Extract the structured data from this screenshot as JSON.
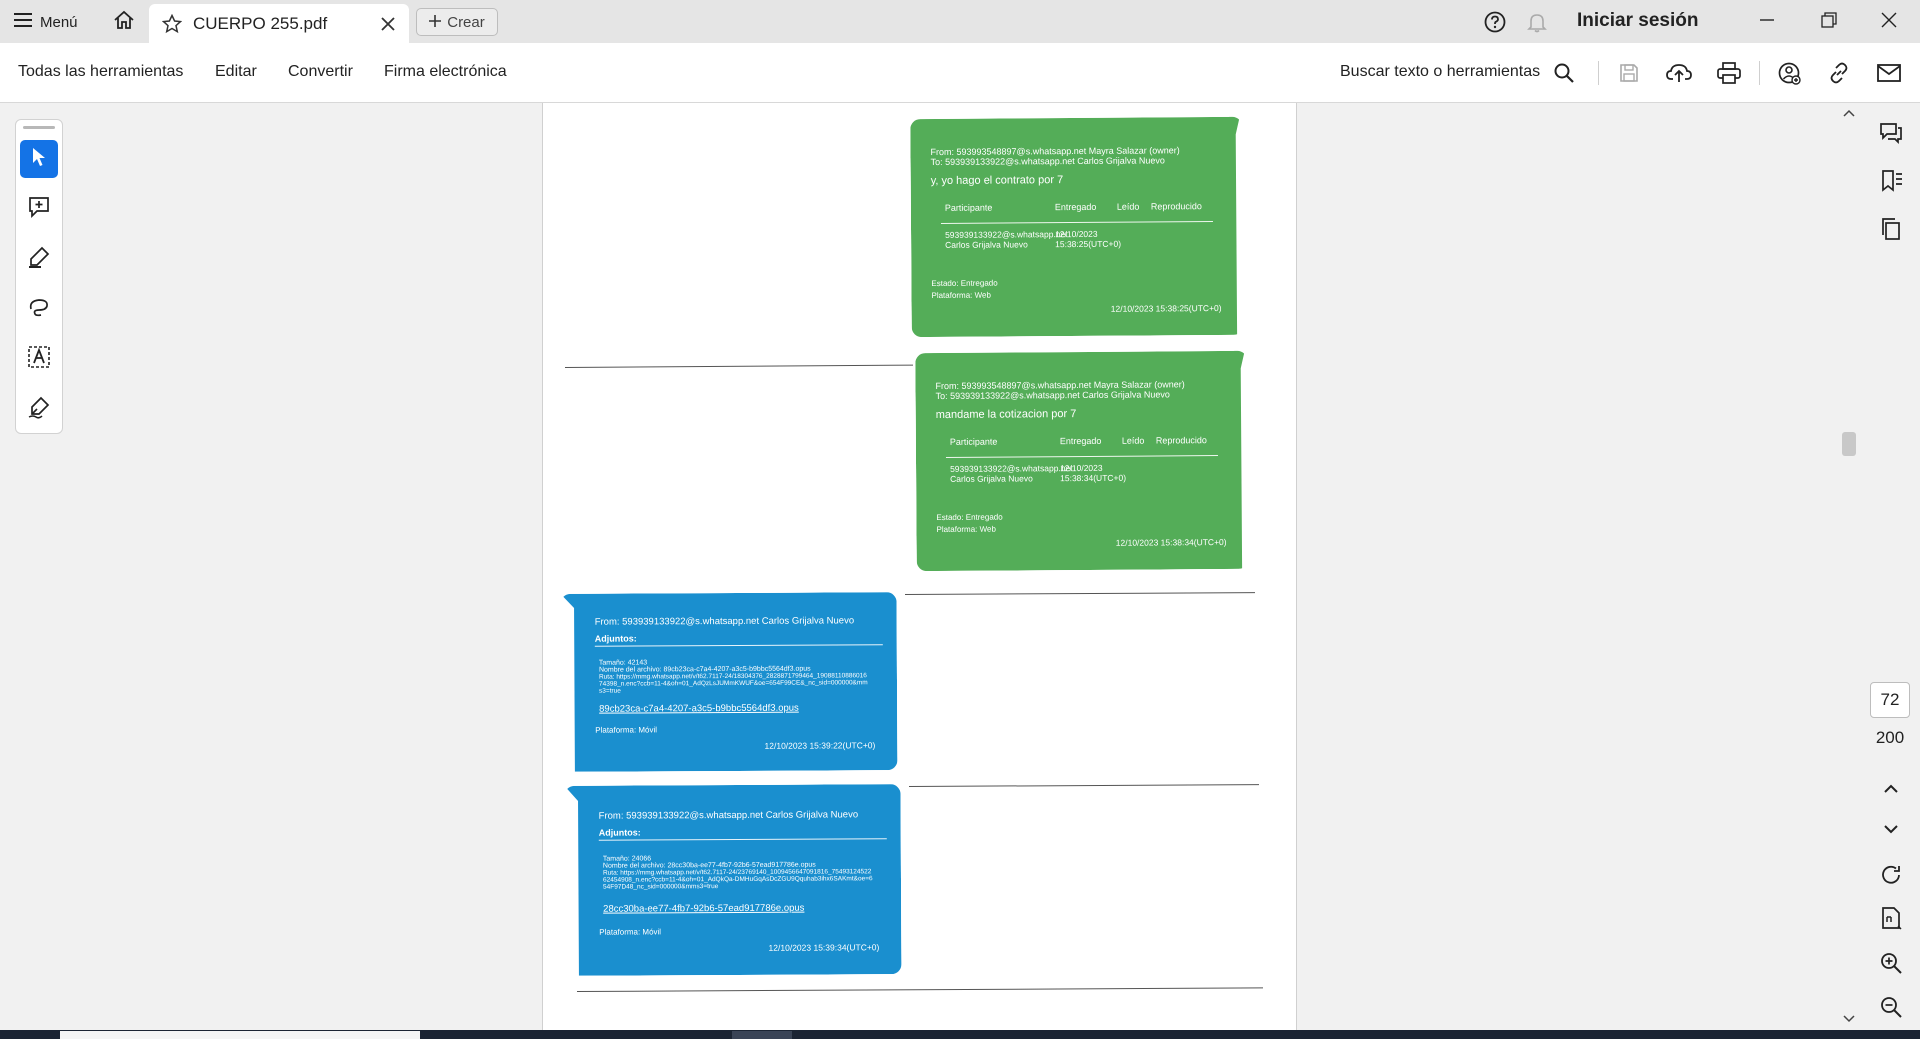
{
  "tabbar": {
    "menu_label": "Menú",
    "tab_title": "CUERPO 255.pdf",
    "create_label": "Crear",
    "signin_label": "Iniciar sesión"
  },
  "toolbar": {
    "items": [
      "Todas las herramientas",
      "Editar",
      "Convertir",
      "Firma electrónica"
    ],
    "search_label": "Buscar texto o herramientas"
  },
  "document": {
    "messages": [
      {
        "type": "green",
        "from": "From: 593993548897@s.whatsapp.net Mayra Salazar (owner)",
        "to": "To: 593939133922@s.whatsapp.net Carlos Grijalva Nuevo",
        "body": "y, yo hago el contrato por 7",
        "col_participant": "Participante",
        "col_delivered": "Entregado",
        "col_read": "Leído",
        "col_played": "Reproducido",
        "row_participant": "593939133922@s.whatsapp.net Carlos Grijalva Nuevo",
        "row_delivered": "12/10/2023 15:38:25(UTC+0)",
        "status": "Estado: Entregado",
        "platform": "Plataforma: Web",
        "timestamp": "12/10/2023 15:38:25(UTC+0)"
      },
      {
        "type": "green",
        "from": "From: 593993548897@s.whatsapp.net Mayra Salazar (owner)",
        "to": "To: 593939133922@s.whatsapp.net Carlos Grijalva Nuevo",
        "body": "mandame la cotizacion por 7",
        "col_participant": "Participante",
        "col_delivered": "Entregado",
        "col_read": "Leído",
        "col_played": "Reproducido",
        "row_participant": "593939133922@s.whatsapp.net Carlos Grijalva Nuevo",
        "row_delivered": "12/10/2023 15:38:34(UTC+0)",
        "status": "Estado: Entregado",
        "platform": "Plataforma: Web",
        "timestamp": "12/10/2023 15:38:34(UTC+0)"
      },
      {
        "type": "blue",
        "from": "From: 593939133922@s.whatsapp.net Carlos Grijalva Nuevo",
        "attachments": "Adjuntos:",
        "size": "Tamaño: 42143",
        "filename": "Nombre del archivo: 89cb23ca-c7a4-4207-a3c5-b9bbc5564df3.opus",
        "path": "Ruta: https://mmg.whatsapp.net/v/t62.7117-24/18304376_2828871799464_1908811088601674398_n.enc?ccb=11-4&oh=01_AdQzLsJUMmKWUF&oe=654F99CE&_nc_sid=000000&mms3=true",
        "link": "89cb23ca-c7a4-4207-a3c5-b9bbc5564df3.opus",
        "platform": "Plataforma: Móvil",
        "timestamp": "12/10/2023 15:39:22(UTC+0)"
      },
      {
        "type": "blue",
        "from": "From: 593939133922@s.whatsapp.net Carlos Grijalva Nuevo",
        "attachments": "Adjuntos:",
        "size": "Tamaño: 24066",
        "filename": "Nombre del archivo: 28cc30ba-ee77-4fb7-92b6-57ead917786e.opus",
        "path": "Ruta: https://mmg.whatsapp.net/v/t62.7117-24/23769140_1009456647091816_7549312452262454908_n.enc?ccb=11-4&oh=01_AdQkQa-DMHuGqAsDcZGU9Qquhab3ihx6SAKmt&oe=654F97D48_nc_sid=000000&mms3=true",
        "link": "28cc30ba-ee77-4fb7-92b6-57ead917786e.opus",
        "platform": "Plataforma: Móvil",
        "timestamp": "12/10/2023 15:39:34(UTC+0)"
      }
    ]
  },
  "pagination": {
    "current_page": "72",
    "total_pages": "200"
  },
  "colors": {
    "accent": "#1473e6",
    "green_bubble": "#54ad58",
    "blue_bubble": "#1a8fcf"
  },
  "icons": {
    "menu": "hamburger-icon",
    "home": "home-icon",
    "star": "star-icon",
    "close": "close-icon",
    "plus": "plus-icon",
    "help": "help-icon",
    "bell": "bell-icon",
    "search": "search-icon",
    "save": "save-icon",
    "upload": "cloud-upload-icon",
    "print": "print-icon",
    "share": "share-icon",
    "link": "link-icon",
    "mail": "mail-icon"
  }
}
